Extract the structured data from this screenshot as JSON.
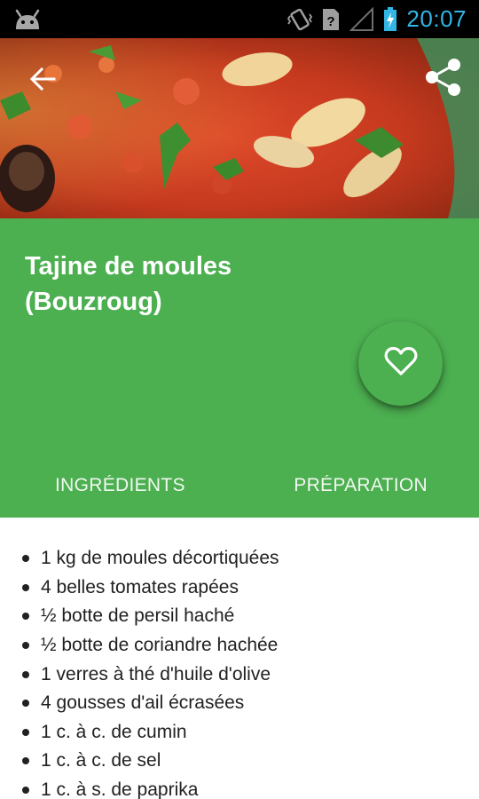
{
  "status_bar": {
    "time": "20:07",
    "icons": [
      "android-icon",
      "vibrate-icon",
      "unknown-sim-icon",
      "signal-icon",
      "battery-charging-icon"
    ]
  },
  "hero": {
    "image": "food-photo-mussels-tajine",
    "back_icon": "arrow-back-icon",
    "share_icon": "share-icon"
  },
  "recipe": {
    "title_line1": "Tajine de moules",
    "title_line2": "(Bouzroug)",
    "favorite_icon": "heart-outline-icon"
  },
  "tabs": [
    {
      "label": "INGRÉDIENTS"
    },
    {
      "label": "PRÉPARATION"
    }
  ],
  "ingredients": [
    "1 kg de moules décortiquées",
    "4 belles tomates rapées",
    "½ botte de persil haché",
    "½ botte de coriandre hachée",
    "1 verres à thé d'huile d'olive",
    "4 gousses d'ail écrasées",
    "1 c. à c. de cumin",
    "1 c. à c. de sel",
    "1 c. à s. de paprika"
  ],
  "colors": {
    "primary": "#4caf50",
    "status_accent": "#33b5e5",
    "text": "#212121"
  }
}
